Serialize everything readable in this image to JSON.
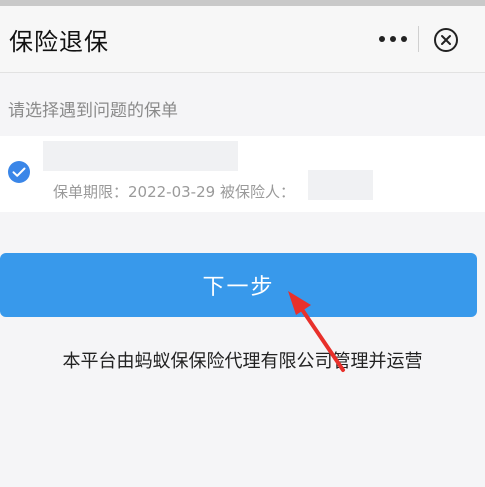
{
  "header": {
    "title": "保险退保",
    "more_icon": "more-dots-icon",
    "close_icon": "close-circle-icon"
  },
  "section": {
    "label": "请选择遇到问题的保单"
  },
  "policy": {
    "selected": true,
    "meta_text": "保单期限：2022-03-29  被保险人：",
    "check_color": "#3a86e8"
  },
  "actions": {
    "next_label": "下一步",
    "primary_color": "#3899eb"
  },
  "footer": {
    "text": "本平台由蚂蚁保保险代理有限公司管理并运营"
  },
  "annotation": {
    "arrow_color": "#e8302b"
  }
}
